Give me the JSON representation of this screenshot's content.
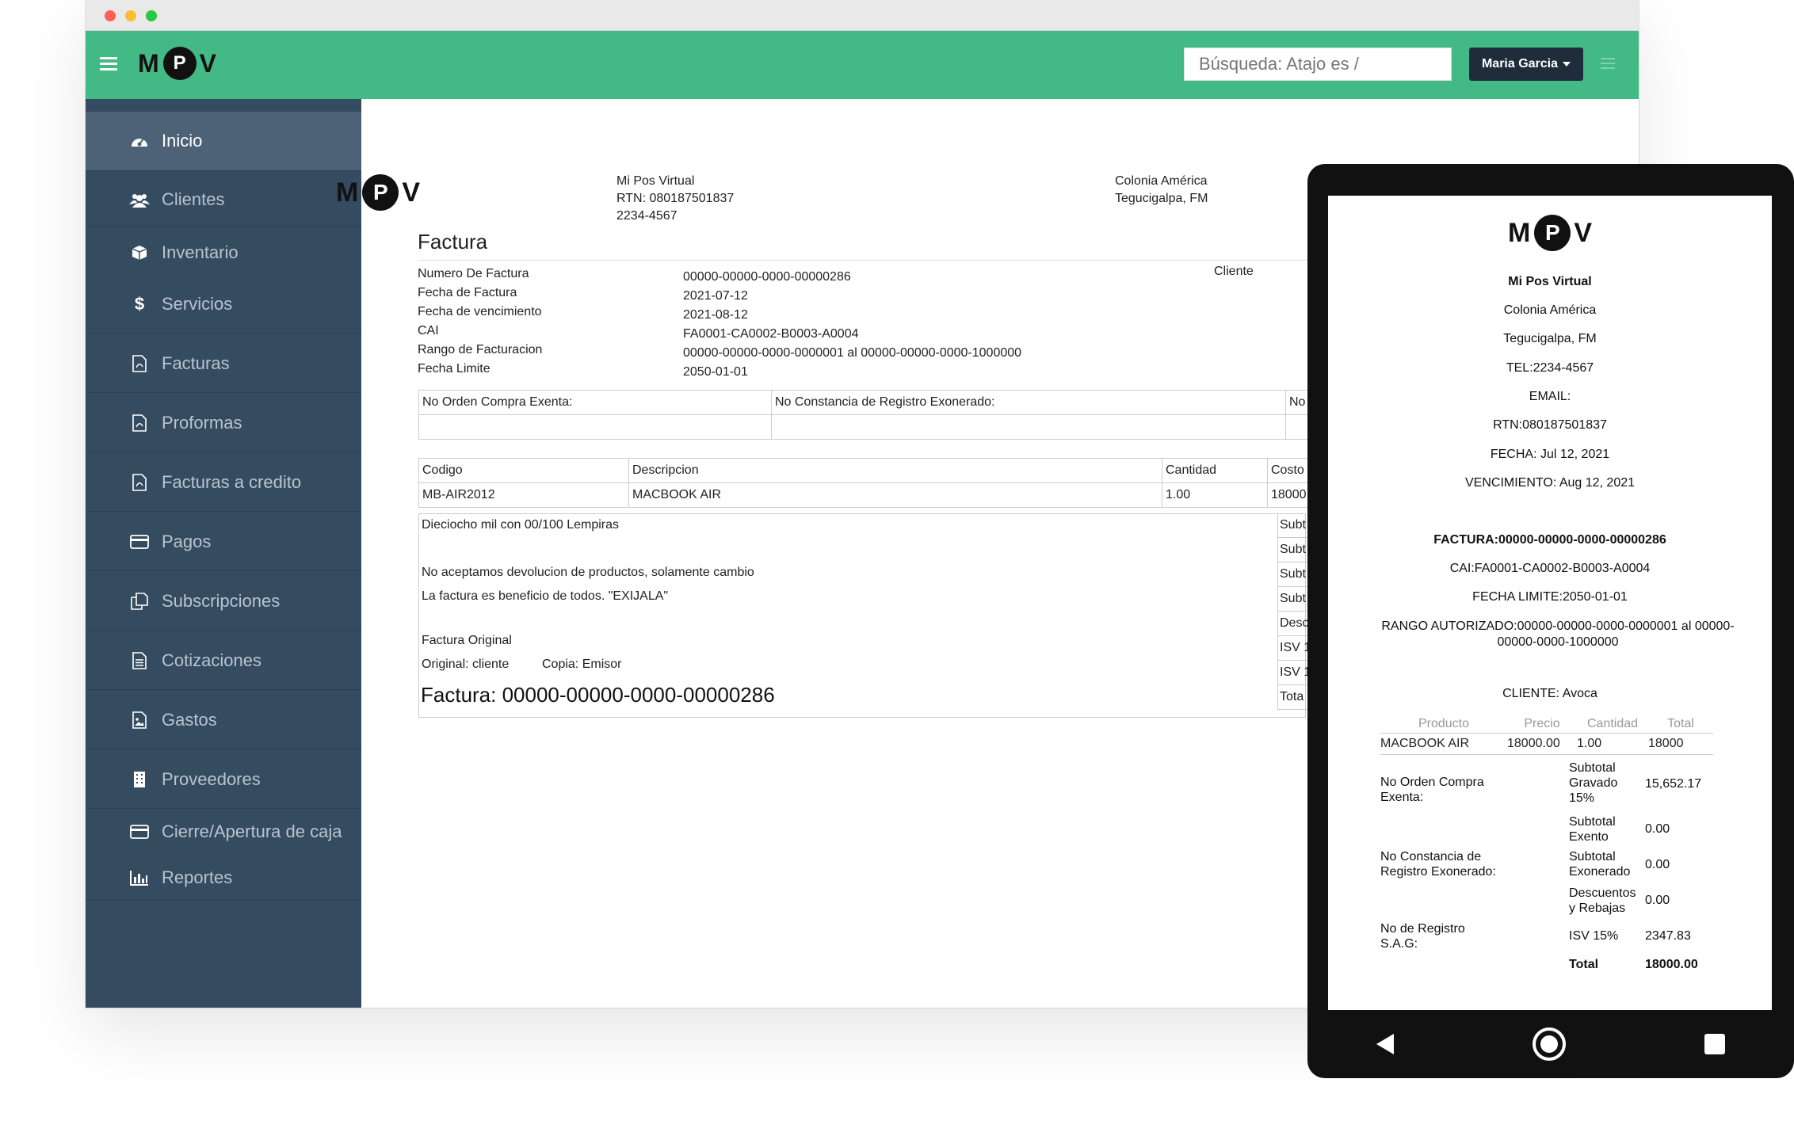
{
  "app": {
    "logo": {
      "m": "M",
      "p": "P",
      "v": "V"
    },
    "search": {
      "placeholder": "Búsqueda: Atajo es /"
    },
    "user": {
      "name": "Maria Garcia"
    }
  },
  "sidebar": {
    "items": [
      {
        "label": "Inicio",
        "icon": "dashboard-icon"
      },
      {
        "label": "Clientes",
        "icon": "users-icon"
      },
      {
        "label": "Inventario",
        "icon": "cube-icon"
      },
      {
        "label": "Servicios",
        "icon": "dollar-icon"
      },
      {
        "label": "Facturas",
        "icon": "pdf-file-icon"
      },
      {
        "label": "Proformas",
        "icon": "pdf-file-icon"
      },
      {
        "label": "Facturas a credito",
        "icon": "pdf-file-icon"
      },
      {
        "label": "Pagos",
        "icon": "credit-card-icon"
      },
      {
        "label": "Subscripciones",
        "icon": "copy-icon"
      },
      {
        "label": "Cotizaciones",
        "icon": "document-icon"
      },
      {
        "label": "Gastos",
        "icon": "image-file-icon"
      },
      {
        "label": "Proveedores",
        "icon": "building-icon"
      },
      {
        "label": "Cierre/Apertura de caja",
        "icon": "credit-card-icon"
      },
      {
        "label": "Reportes",
        "icon": "bar-chart-icon"
      }
    ]
  },
  "invoice": {
    "company": {
      "name": "Mi Pos Virtual",
      "rtn": "RTN: 080187501837",
      "phone": "2234-4567"
    },
    "address": {
      "line1": "Colonia América",
      "line2": "Tegucigalpa, FM"
    },
    "title": "Factura",
    "meta": {
      "labels": [
        "Numero De Factura",
        "Fecha de Factura",
        "Fecha de vencimiento",
        "CAI",
        "Rango de Facturacion",
        "Fecha Limite"
      ],
      "values": [
        "00000-00000-0000-00000286",
        "2021-07-12",
        "2021-08-12",
        "FA0001-CA0002-B0003-A0004",
        "00000-00000-0000-0000001 al 00000-00000-0000-1000000",
        "2050-01-01"
      ],
      "client_label": "Cliente"
    },
    "exempt": {
      "col1": "No Orden Compra Exenta:",
      "col2": "No Constancia de Registro Exonerado:",
      "col3": "No"
    },
    "items": {
      "headers": [
        "Codigo",
        "Descripcion",
        "Cantidad",
        "Costo u"
      ],
      "rows": [
        [
          "MB-AIR2012",
          "MACBOOK AIR",
          "1.00",
          "18000."
        ]
      ]
    },
    "amount_words": "Dieciocho mil con 00/100 Lempiras",
    "note1": "No aceptamos devolucion de productos, solamente cambio",
    "note2": "La factura es beneficio de todos. \"EXIJALA\"",
    "copy_title": "Factura Original",
    "copy_original": "Original: cliente",
    "copy_copy": "Copia: Emisor",
    "big_number": "Factura: 00000-00000-0000-00000286",
    "totals_labels": [
      "Subt",
      "Subt",
      "Subt",
      "Subt",
      "Desc",
      "ISV 1",
      "ISV 1",
      "Tota"
    ]
  },
  "receipt": {
    "company": "Mi Pos Virtual",
    "line1": "Colonia América",
    "line2": "Tegucigalpa, FM",
    "tel": "TEL:2234-4567",
    "email": "EMAIL:",
    "rtn": "RTN:080187501837",
    "fecha": "FECHA: Jul 12, 2021",
    "vencimiento": "VENCIMIENTO: Aug 12, 2021",
    "factura": "FACTURA:00000-00000-0000-00000286",
    "cai": "CAI:FA0001-CA0002-B0003-A0004",
    "fecha_limite": "FECHA LIMITE:2050-01-01",
    "rango": "RANGO AUTORIZADO:00000-00000-0000-0000001 al 00000-00000-0000-1000000",
    "cliente": "CLIENTE: Avoca",
    "table": {
      "headers": [
        "Producto",
        "Precio",
        "Cantidad",
        "Total"
      ],
      "row": [
        "MACBOOK AIR",
        "18000.00",
        "1.00",
        "18000"
      ]
    },
    "left_labels": {
      "orden": "No Orden Compra Exenta:",
      "constancia": "No Constancia de Registro Exonerado:",
      "sag": "No de Registro S.A.G:"
    },
    "totals": [
      {
        "label": "Subtotal Gravado 15%",
        "value": "15,652.17"
      },
      {
        "label": "Subtotal Exento",
        "value": "0.00"
      },
      {
        "label": "Subtotal Exonerado",
        "value": "0.00"
      },
      {
        "label": "Descuentos y Rebajas",
        "value": "0.00"
      },
      {
        "label": "ISV 15%",
        "value": "2347.83"
      },
      {
        "label": "Total",
        "value": "18000.00"
      }
    ]
  },
  "colors": {
    "navbar": "#43b985",
    "sidebar": "#354b60",
    "sidebar_active": "#4d6276",
    "user_button": "#1e2c3c"
  }
}
